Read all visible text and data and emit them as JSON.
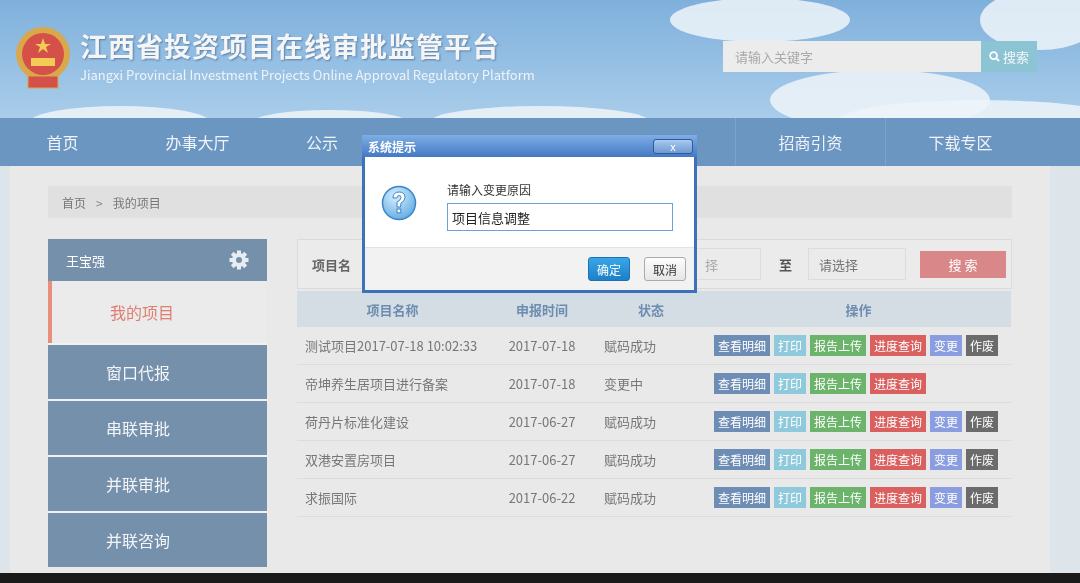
{
  "header": {
    "title": "江西省投资项目在线审批监管平台",
    "subtitle": "Jiangxi Provincial Investment Projects Online Approval Regulatory Platform",
    "search": {
      "placeholder": "请输入关键字",
      "button": "搜索"
    }
  },
  "nav": {
    "left": [
      {
        "label": "首页"
      },
      {
        "label": "办事大厅"
      },
      {
        "label": "公示"
      }
    ],
    "right": [
      {
        "label": "招商引资"
      },
      {
        "label": "下载专区"
      }
    ]
  },
  "breadcrumb": {
    "items": [
      "首页",
      "我的项目"
    ],
    "separator": ">"
  },
  "sidebar": {
    "user": "王宝强",
    "items": [
      {
        "label": "我的项目",
        "selected": true
      },
      {
        "label": "窗口代报",
        "selected": false
      },
      {
        "label": "串联审批",
        "selected": false
      },
      {
        "label": "并联审批",
        "selected": false
      },
      {
        "label": "并联咨询",
        "selected": false
      }
    ]
  },
  "filter": {
    "label": "项目名",
    "date_from": "择",
    "to": "至",
    "date_to_placeholder": "请选择",
    "button": "搜 索"
  },
  "table": {
    "columns": [
      "项目名称",
      "申报时间",
      "状态",
      "操作"
    ],
    "rows": [
      {
        "name": "测试项目2017-07-18 10:02:33",
        "date": "2017-07-18",
        "status": "赋码成功",
        "actions": [
          {
            "label": "查看明细",
            "color": "#6e8db5"
          },
          {
            "label": "打印",
            "color": "#8fcadc"
          },
          {
            "label": "报告上传",
            "color": "#6cb36c"
          },
          {
            "label": "进度查询",
            "color": "#d9605f"
          },
          {
            "label": "变更",
            "color": "#8a9de0"
          },
          {
            "label": "作废",
            "color": "#6b6b6b"
          }
        ]
      },
      {
        "name": "帝坤养生居项目进行备案",
        "date": "2017-07-18",
        "status": "变更中",
        "actions": [
          {
            "label": "查看明细",
            "color": "#6e8db5"
          },
          {
            "label": "打印",
            "color": "#8fcadc"
          },
          {
            "label": "报告上传",
            "color": "#6cb36c"
          },
          {
            "label": "进度查询",
            "color": "#d9605f"
          }
        ]
      },
      {
        "name": "荷丹片标准化建设",
        "date": "2017-06-27",
        "status": "赋码成功",
        "actions": [
          {
            "label": "查看明细",
            "color": "#6e8db5"
          },
          {
            "label": "打印",
            "color": "#8fcadc"
          },
          {
            "label": "报告上传",
            "color": "#6cb36c"
          },
          {
            "label": "进度查询",
            "color": "#d9605f"
          },
          {
            "label": "变更",
            "color": "#8a9de0"
          },
          {
            "label": "作废",
            "color": "#6b6b6b"
          }
        ]
      },
      {
        "name": "双港安置房项目",
        "date": "2017-06-27",
        "status": "赋码成功",
        "actions": [
          {
            "label": "查看明细",
            "color": "#6e8db5"
          },
          {
            "label": "打印",
            "color": "#8fcadc"
          },
          {
            "label": "报告上传",
            "color": "#6cb36c"
          },
          {
            "label": "进度查询",
            "color": "#d9605f"
          },
          {
            "label": "变更",
            "color": "#8a9de0"
          },
          {
            "label": "作废",
            "color": "#6b6b6b"
          }
        ]
      },
      {
        "name": "求振国际",
        "date": "2017-06-22",
        "status": "赋码成功",
        "actions": [
          {
            "label": "查看明细",
            "color": "#6e8db5"
          },
          {
            "label": "打印",
            "color": "#8fcadc"
          },
          {
            "label": "报告上传",
            "color": "#6cb36c"
          },
          {
            "label": "进度查询",
            "color": "#d9605f"
          },
          {
            "label": "变更",
            "color": "#8a9de0"
          },
          {
            "label": "作废",
            "color": "#6b6b6b"
          }
        ]
      }
    ]
  },
  "dialog": {
    "title": "系统提示",
    "close": "x",
    "prompt": "请输入变更原因",
    "value": "项目信息调整",
    "buttons": [
      {
        "label": "确定",
        "kind": "primary"
      },
      {
        "label": "取消",
        "kind": "secondary"
      }
    ]
  }
}
